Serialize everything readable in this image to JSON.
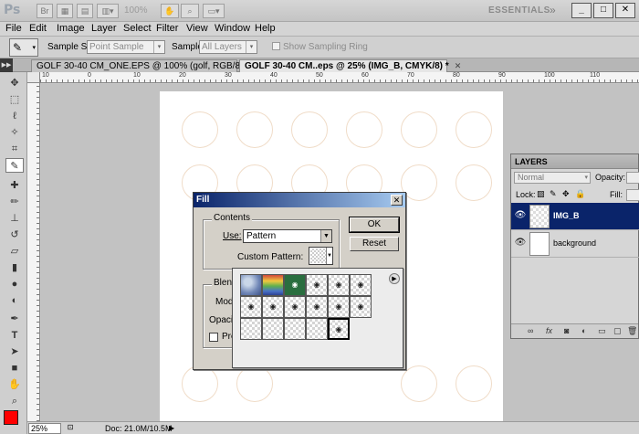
{
  "app": {
    "logo": "Ps",
    "zoom_display": "100%",
    "workspace": "ESSENTIALS",
    "workspace_arrow": "»",
    "win_min": "_",
    "win_max": "□",
    "win_close": "✕"
  },
  "menu": [
    "File",
    "Edit",
    "Image",
    "Layer",
    "Select",
    "Filter",
    "View",
    "Window",
    "Help"
  ],
  "options": {
    "sample_size_label": "Sample Size:",
    "sample_size_value": "Point Sample",
    "sample_label": "Sample:",
    "sample_value": "All Layers",
    "sampling_ring_label": "Show Sampling Ring"
  },
  "tabs": [
    {
      "label": "GOLF 30-40 CM_ONE.EPS @ 100% (golf, RGB/8) *"
    },
    {
      "label": "GOLF 30-40 CM..eps @ 25% (IMG_B, CMYK/8) *"
    }
  ],
  "ruler_top_labels": [
    "10",
    "0",
    "10",
    "20",
    "30",
    "40",
    "50",
    "60",
    "70",
    "80",
    "90",
    "100",
    "110"
  ],
  "status": {
    "zoom": "25%",
    "doc": "Doc: 21.0M/10.5M"
  },
  "layers": {
    "title": "LAYERS",
    "blend_mode": "Normal",
    "opacity_label": "Opacity:",
    "lock_label": "Lock:",
    "fill_label": "Fill:",
    "items": [
      {
        "name": "IMG_B",
        "selected": true
      },
      {
        "name": "background",
        "selected": false
      }
    ]
  },
  "fill_dialog": {
    "title": "Fill",
    "contents_label": "Contents",
    "use_label": "Use:",
    "use_value": "Pattern",
    "custom_pattern_label": "Custom Pattern:",
    "blending_label": "Blen",
    "mode_label": "Mod",
    "opacity_label": "Opacit",
    "preserve_label": "Pre",
    "ok_label": "OK",
    "reset_label": "Reset"
  },
  "colors": {
    "foreground": "#ff0000",
    "selection": "#0a246a"
  }
}
